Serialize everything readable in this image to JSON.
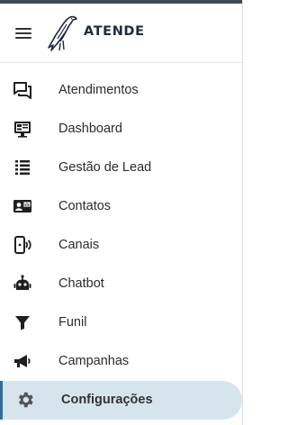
{
  "header": {
    "menu_icon": "hamburger-icon",
    "logo_text": "ATENDE",
    "logo_icon": "eagle-logo"
  },
  "colors": {
    "topbar": "#3f4a56",
    "active_bg": "#d6e4ee",
    "active_indicator": "#2f6f9e",
    "icon": "#1f1f1f"
  },
  "menu": {
    "items": [
      {
        "label": "Atendimentos",
        "icon": "chat-bubbles-icon"
      },
      {
        "label": "Dashboard",
        "icon": "monitor-dashboard-icon"
      },
      {
        "label": "Gestão de Lead",
        "icon": "list-icon"
      },
      {
        "label": "Contatos",
        "icon": "contact-card-icon"
      },
      {
        "label": "Canais",
        "icon": "phone-signal-icon"
      },
      {
        "label": "Chatbot",
        "icon": "robot-icon"
      },
      {
        "label": "Funil",
        "icon": "funnel-icon"
      },
      {
        "label": "Campanhas",
        "icon": "megaphone-icon"
      },
      {
        "label": "Configurações",
        "icon": "gear-icon",
        "active": true
      }
    ]
  }
}
